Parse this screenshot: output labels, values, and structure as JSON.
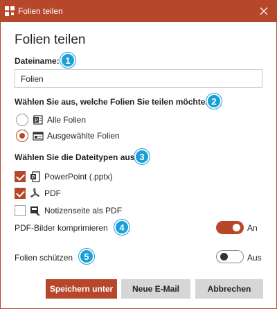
{
  "window": {
    "title": "Folien teilen"
  },
  "heading": "Folien teilen",
  "filename": {
    "label": "Dateiname:",
    "value": "Folien",
    "badge": "1"
  },
  "slides": {
    "label": "Wählen Sie aus, welche Folien Sie teilen möchten:",
    "badge": "2",
    "options": [
      {
        "label": "Alle Folien",
        "checked": false
      },
      {
        "label": "Ausgewählte Folien",
        "checked": true
      }
    ]
  },
  "filetypes": {
    "label": "Wählen Sie die Dateitypen aus:",
    "badge": "3",
    "options": [
      {
        "label": "PowerPoint (.pptx)",
        "checked": true
      },
      {
        "label": "PDF",
        "checked": true
      },
      {
        "label": "Notizenseite als PDF",
        "checked": false
      }
    ]
  },
  "compress": {
    "label": "PDF-Bilder komprimieren",
    "state": "An",
    "on": true,
    "badge": "4"
  },
  "protect": {
    "label": "Folien schützen",
    "state": "Aus",
    "on": false,
    "badge": "5"
  },
  "buttons": {
    "save": "Speichern unter",
    "email": "Neue E-Mail",
    "cancel": "Abbrechen"
  },
  "colors": {
    "accent": "#b7472a",
    "badge": "#1a9fd8",
    "secondary_button": "#d6d6d6"
  }
}
